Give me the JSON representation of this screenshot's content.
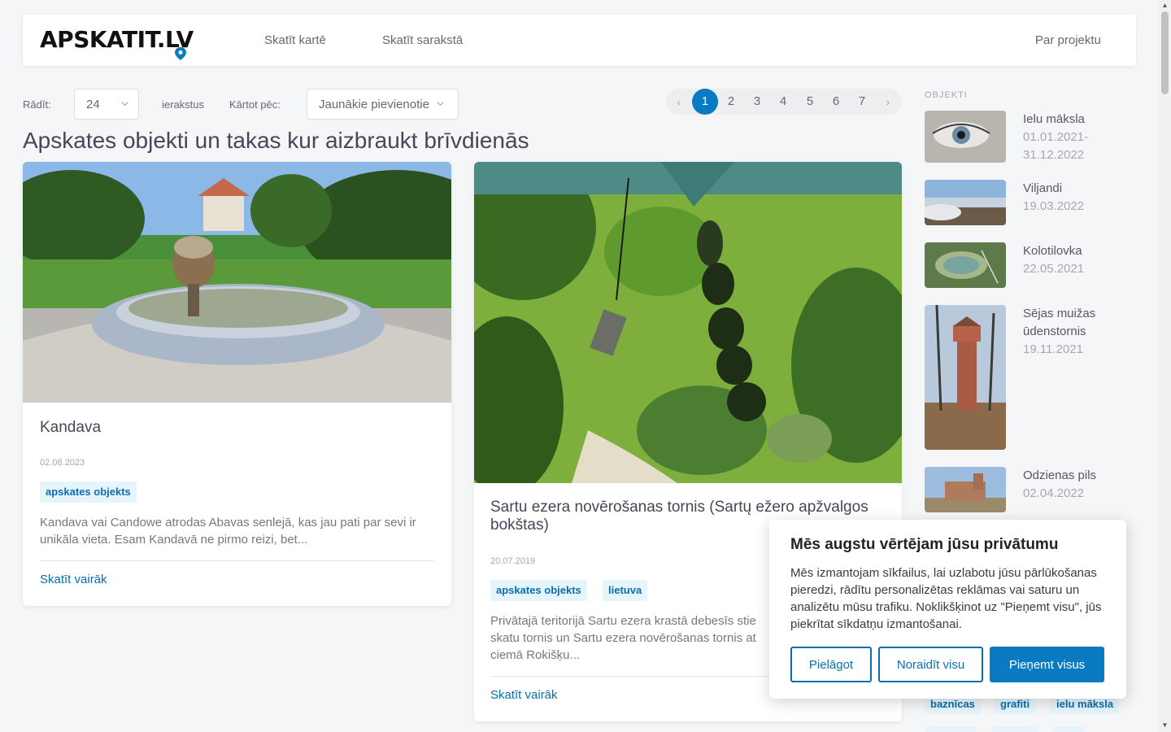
{
  "header": {
    "logo_text": "APSKATIT.LV",
    "nav": [
      "Skatīt kartē",
      "Skatīt sarakstā"
    ],
    "about": "Par projektu"
  },
  "controls": {
    "show_label": "Rādīt:",
    "show_value": "24",
    "records_label": "ierakstus",
    "sort_label": "Kārtot pēc:",
    "sort_value": "Jaunākie pievienotie"
  },
  "pagination": {
    "prev": "‹",
    "pages": [
      "1",
      "2",
      "3",
      "4",
      "5",
      "6",
      "7"
    ],
    "active": "1",
    "next": "›"
  },
  "page_title": "Apskates objekti un takas kur aizbraukt brīvdienās",
  "cards": [
    {
      "title": "Kandava",
      "date": "02.08.2023",
      "tags": [
        "apskates objekts"
      ],
      "excerpt": "Kandava vai Candowe atrodas Abavas senlejā, kas jau pati par sevi ir unikāla vieta. Esam Kandavā ne pirmo reizi, bet...",
      "more": "Skatīt vairāk"
    },
    {
      "title": "Sartu ezera novērošanas tornis (Sartų ežero apžvalgos bokštas)",
      "date": "20.07.2019",
      "tags": [
        "apskates objekts",
        "lietuva"
      ],
      "excerpt": "Privātajā teritorijā Sartu ezera krastā debesīs stie skatu tornis un Sartu ezera novērošanas tornis at ciemā Rokišķu...",
      "more": "Skatīt vairāk"
    }
  ],
  "sidebar": {
    "heading": "OBJEKTI",
    "items": [
      {
        "name": "Ielu māksla",
        "date": "01.01.2021-31.12.2022"
      },
      {
        "name": "Viljandi",
        "date": "19.03.2022"
      },
      {
        "name": "Kolotilovka",
        "date": "22.05.2021"
      },
      {
        "name": "Sējas muižas ūdenstornis",
        "date": "19.11.2021"
      },
      {
        "name": "Odzienas pils",
        "date": "02.04.2022"
      }
    ],
    "tags": [
      "baznīcas",
      "grafiti",
      "ielu māksla"
    ]
  },
  "cookie": {
    "title": "Mēs augstu vērtējam jūsu privātumu",
    "text": "Mēs izmantojam sīkfailus, lai uzlabotu jūsu pārlūkošanas pieredzi, rādītu personalizētas reklāmas vai saturu un analizētu mūsu trafiku. Noklikšķinot uz \"Pieņemt visu\", jūs piekrītat sīkdatņu izmantošanai.",
    "customize": "Pielāgot",
    "reject": "Noraidīt visu",
    "accept": "Pieņemt visus"
  },
  "colors": {
    "accent": "#0a7bc2",
    "link": "#0a6fae",
    "tag_bg": "#e6f4fb",
    "page_bg": "#f5f6f7"
  }
}
